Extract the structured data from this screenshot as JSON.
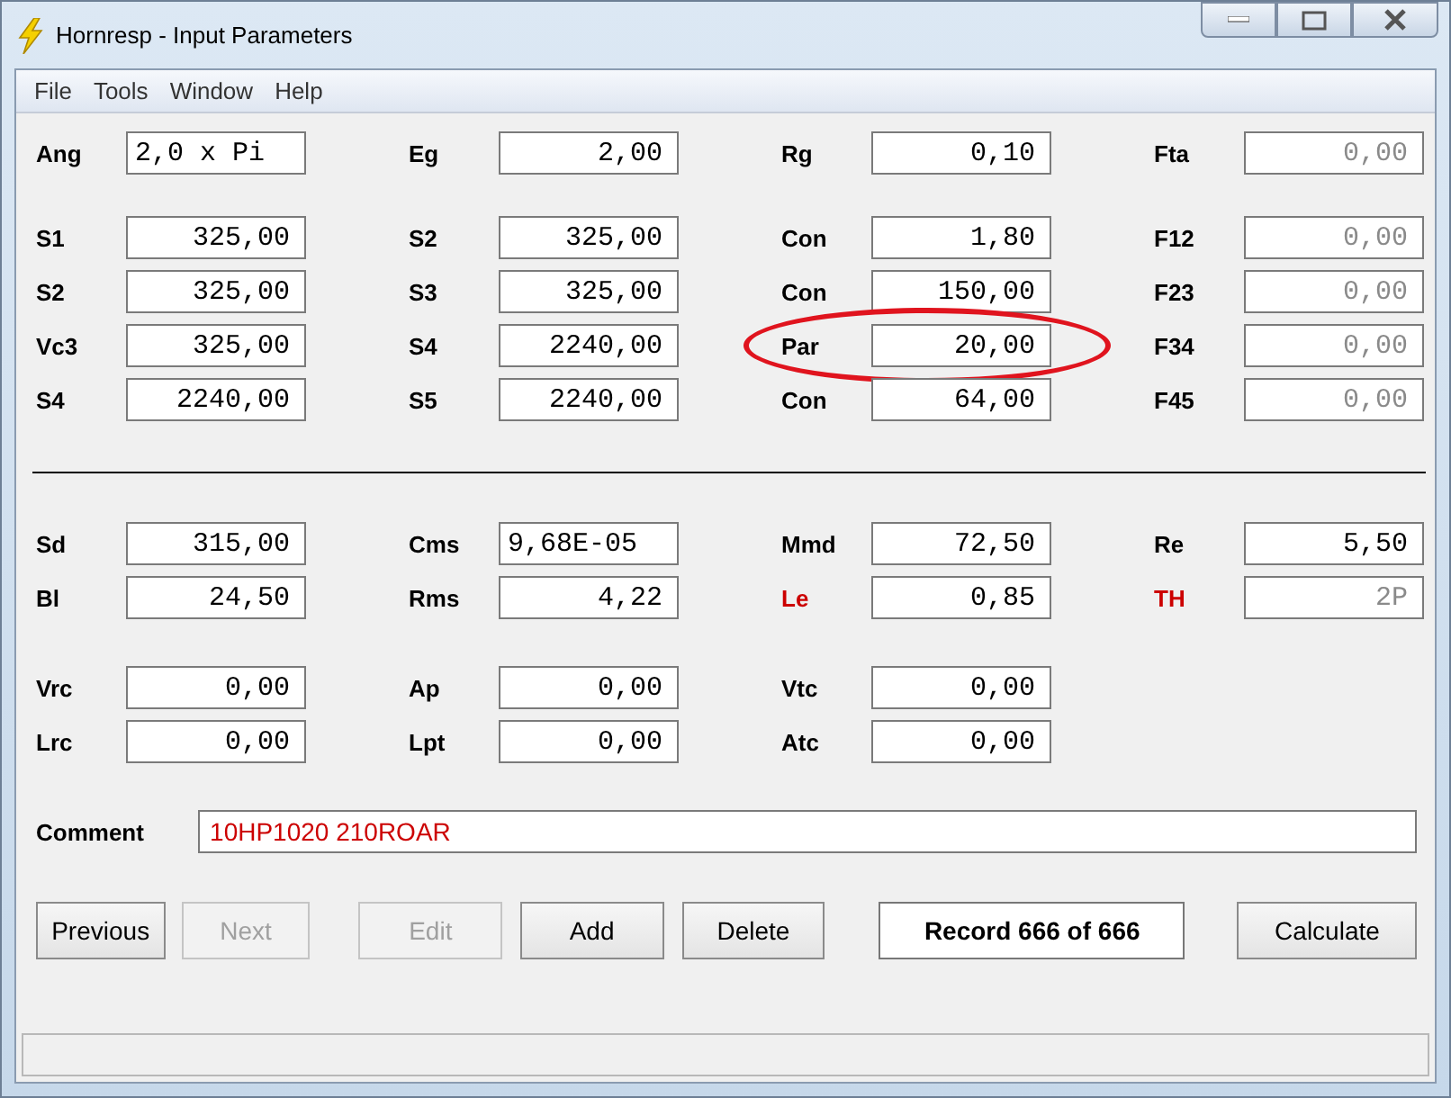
{
  "window": {
    "title": "Hornresp - Input Parameters"
  },
  "menu": [
    "File",
    "Tools",
    "Window",
    "Help"
  ],
  "groups": [
    {
      "rows": [
        [
          {
            "label": "Ang",
            "value": "2,0 x Pi",
            "kind": "text",
            "disabled": false,
            "color": "#000000",
            "circled": false
          },
          {
            "label": "Eg",
            "value": "2,00",
            "kind": "number",
            "disabled": false,
            "color": "#000000",
            "circled": false
          },
          {
            "label": "Rg",
            "value": "0,10",
            "kind": "number",
            "disabled": false,
            "color": "#000000",
            "circled": false
          },
          {
            "label": "Fta",
            "value": "0,00",
            "kind": "number",
            "disabled": true,
            "color": "#000000",
            "circled": false
          }
        ]
      ]
    },
    {
      "rows": [
        [
          {
            "label": "S1",
            "value": "325,00",
            "kind": "number",
            "disabled": false,
            "color": "#000000",
            "circled": false
          },
          {
            "label": "S2",
            "value": "325,00",
            "kind": "number",
            "disabled": false,
            "color": "#000000",
            "circled": false
          },
          {
            "label": "Con",
            "value": "1,80",
            "kind": "number",
            "disabled": false,
            "color": "#000000",
            "circled": false
          },
          {
            "label": "F12",
            "value": "0,00",
            "kind": "number",
            "disabled": true,
            "color": "#000000",
            "circled": false
          }
        ],
        [
          {
            "label": "S2",
            "value": "325,00",
            "kind": "number",
            "disabled": false,
            "color": "#000000",
            "circled": false
          },
          {
            "label": "S3",
            "value": "325,00",
            "kind": "number",
            "disabled": false,
            "color": "#000000",
            "circled": false
          },
          {
            "label": "Con",
            "value": "150,00",
            "kind": "number",
            "disabled": false,
            "color": "#000000",
            "circled": false
          },
          {
            "label": "F23",
            "value": "0,00",
            "kind": "number",
            "disabled": true,
            "color": "#000000",
            "circled": false
          }
        ],
        [
          {
            "label": "Vc3",
            "value": "325,00",
            "kind": "number",
            "disabled": false,
            "color": "#000000",
            "circled": false
          },
          {
            "label": "S4",
            "value": "2240,00",
            "kind": "number",
            "disabled": false,
            "color": "#000000",
            "circled": false
          },
          {
            "label": "Par",
            "value": "20,00",
            "kind": "number",
            "disabled": false,
            "color": "#000000",
            "circled": true
          },
          {
            "label": "F34",
            "value": "0,00",
            "kind": "number",
            "disabled": true,
            "color": "#000000",
            "circled": false
          }
        ],
        [
          {
            "label": "S4",
            "value": "2240,00",
            "kind": "number",
            "disabled": false,
            "color": "#000000",
            "circled": false
          },
          {
            "label": "S5",
            "value": "2240,00",
            "kind": "number",
            "disabled": false,
            "color": "#000000",
            "circled": false
          },
          {
            "label": "Con",
            "value": "64,00",
            "kind": "number",
            "disabled": false,
            "color": "#000000",
            "circled": false
          },
          {
            "label": "F45",
            "value": "0,00",
            "kind": "number",
            "disabled": true,
            "color": "#000000",
            "circled": false
          }
        ]
      ]
    },
    {
      "divider": true,
      "rows": [
        [
          {
            "label": "Sd",
            "value": "315,00",
            "kind": "number",
            "disabled": false,
            "color": "#000000",
            "circled": false
          },
          {
            "label": "Cms",
            "value": "9,68E-05",
            "kind": "text",
            "disabled": false,
            "color": "#000000",
            "circled": false
          },
          {
            "label": "Mmd",
            "value": "72,50",
            "kind": "number",
            "disabled": false,
            "color": "#000000",
            "circled": false
          },
          {
            "label": "Re",
            "value": "5,50",
            "kind": "number",
            "disabled": false,
            "color": "#000000",
            "circled": false
          }
        ],
        [
          {
            "label": "Bl",
            "value": "24,50",
            "kind": "number",
            "disabled": false,
            "color": "#000000",
            "circled": false
          },
          {
            "label": "Rms",
            "value": "4,22",
            "kind": "number",
            "disabled": false,
            "color": "#000000",
            "circled": false
          },
          {
            "label": "Le",
            "value": "0,85",
            "kind": "number",
            "disabled": false,
            "color": "#cc0000",
            "circled": false
          },
          {
            "label": "TH",
            "value": "2P",
            "kind": "number",
            "disabled": true,
            "color": "#cc0000",
            "circled": false
          }
        ]
      ]
    },
    {
      "rows": [
        [
          {
            "label": "Vrc",
            "value": "0,00",
            "kind": "number",
            "disabled": false,
            "color": "#000000",
            "circled": false
          },
          {
            "label": "Ap",
            "value": "0,00",
            "kind": "number",
            "disabled": false,
            "color": "#000000",
            "circled": false
          },
          {
            "label": "Vtc",
            "value": "0,00",
            "kind": "number",
            "disabled": false,
            "color": "#000000",
            "circled": false
          }
        ],
        [
          {
            "label": "Lrc",
            "value": "0,00",
            "kind": "number",
            "disabled": false,
            "color": "#000000",
            "circled": false
          },
          {
            "label": "Lpt",
            "value": "0,00",
            "kind": "number",
            "disabled": false,
            "color": "#000000",
            "circled": false
          },
          {
            "label": "Atc",
            "value": "0,00",
            "kind": "number",
            "disabled": false,
            "color": "#000000",
            "circled": false
          }
        ]
      ]
    }
  ],
  "comment": {
    "label": "Comment",
    "value": "10HP1020 210ROAR"
  },
  "buttons": [
    {
      "label": "Previous",
      "kind": "button",
      "disabled": false
    },
    {
      "label": "Next",
      "kind": "button",
      "disabled": true
    },
    {
      "label": "Edit",
      "kind": "button",
      "disabled": true
    },
    {
      "label": "Add",
      "kind": "button",
      "disabled": false
    },
    {
      "label": "Delete",
      "kind": "button",
      "disabled": false
    },
    {
      "label": "Record 666 of 666",
      "kind": "display"
    },
    {
      "label": "Calculate",
      "kind": "button",
      "disabled": false
    }
  ]
}
